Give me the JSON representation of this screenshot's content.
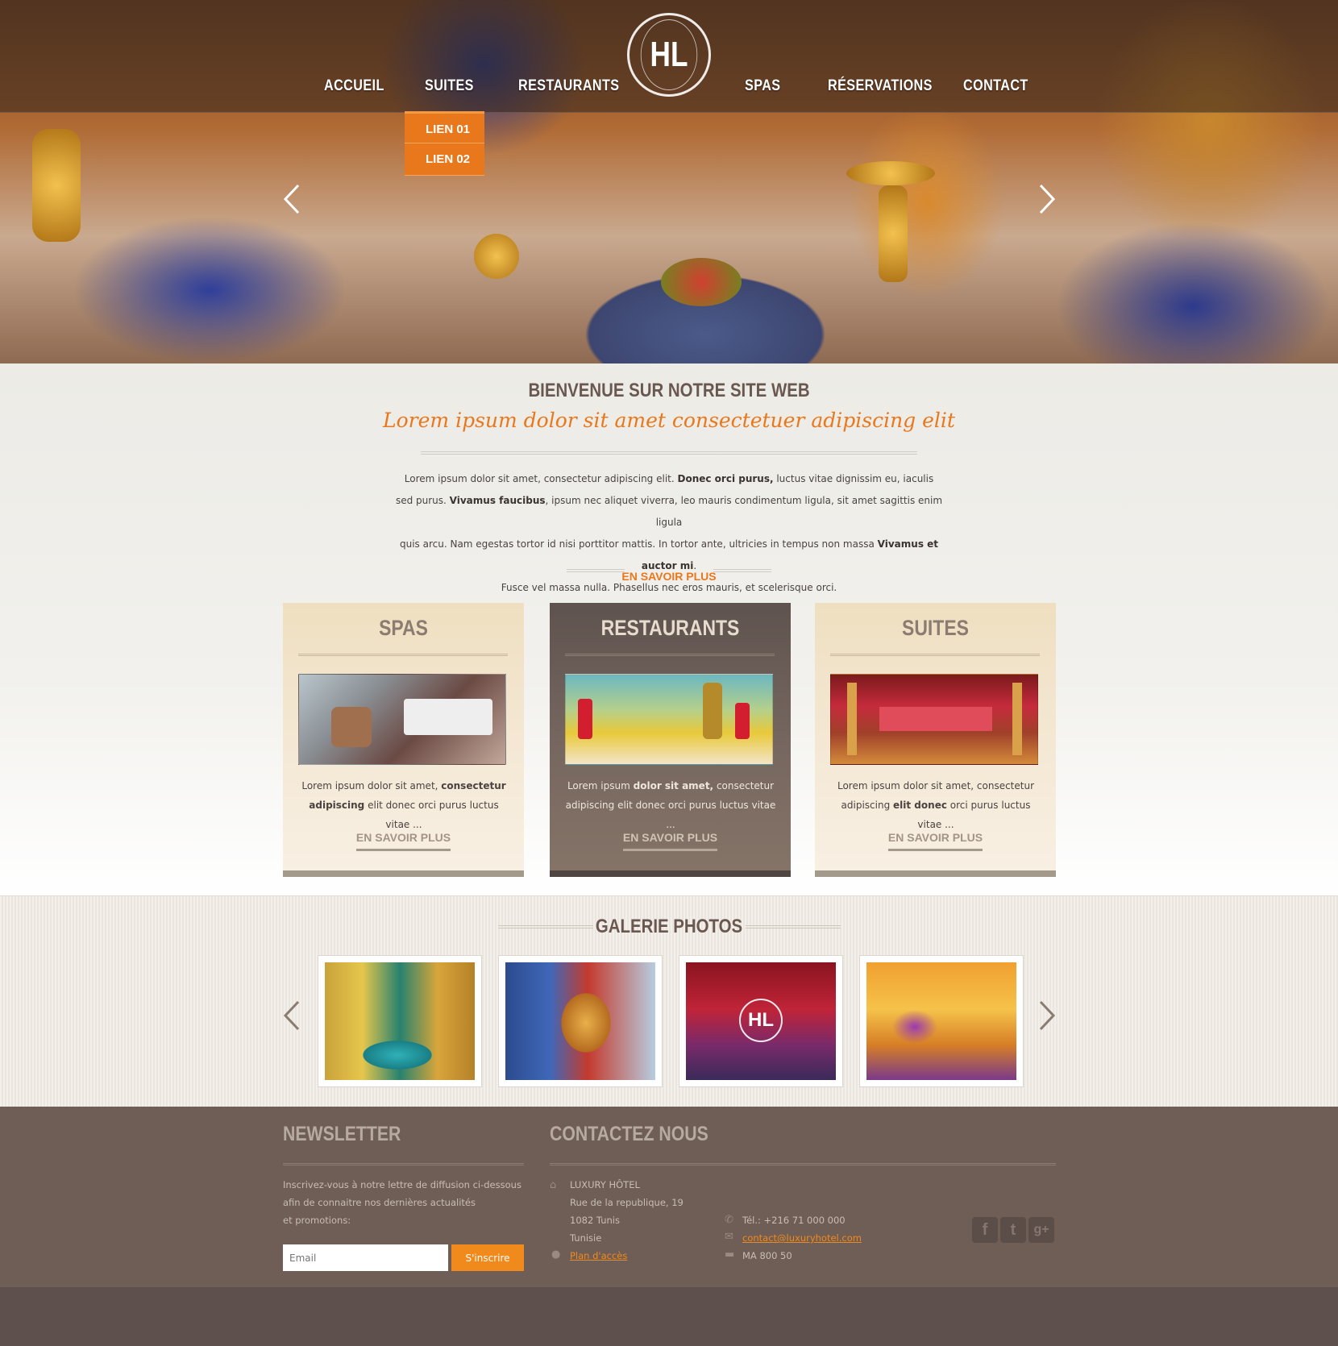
{
  "nav": {
    "items": [
      "ACCUEIL",
      "SUITES",
      "RESTAURANTS",
      "SPAS",
      "RÉSERVATIONS",
      "CONTACT"
    ],
    "logo": "HL",
    "dropdown": [
      "LIEN 01",
      "LIEN 02"
    ]
  },
  "welcome": {
    "title": "BIENVENUE SUR NOTRE SITE WEB",
    "subtitle": "Lorem ipsum dolor sit amet consectetuer adipiscing elit",
    "lines": [
      [
        "Lorem ipsum dolor sit amet, consectetur adipiscing elit. ",
        "Donec orci purus,",
        " luctus vitae dignissim eu, iaculis"
      ],
      [
        "sed purus. ",
        "Vivamus faucibus",
        ", ipsum nec aliquet viverra, leo mauris condimentum ligula, sit amet sagittis enim ligula"
      ],
      [
        "quis arcu. Nam egestas tortor id nisi porttitor mattis. In tortor ante, ultricies in  tempus non massa ",
        "Vivamus et auctor mi",
        "."
      ],
      [
        "Fusce vel massa nulla. Phasellus nec eros mauris, et scelerisque orci.",
        "",
        ""
      ]
    ],
    "more": "EN SAVOIR PLUS"
  },
  "cards": [
    {
      "title": "SPAS",
      "text": [
        "Lorem ipsum dolor sit amet, ",
        "consectetur adipiscing",
        " elit donec orci purus luctus vitae ..."
      ],
      "more": "EN SAVOIR PLUS"
    },
    {
      "title": "RESTAURANTS",
      "text": [
        "Lorem ipsum ",
        "dolor sit amet,",
        " consectetur adipiscing elit donec orci purus luctus vitae ..."
      ],
      "more": "EN SAVOIR PLUS"
    },
    {
      "title": "SUITES",
      "text": [
        "Lorem ipsum dolor sit amet, consectetur adipiscing ",
        "elit donec",
        " orci purus luctus vitae ..."
      ],
      "more": "EN SAVOIR PLUS"
    }
  ],
  "gallery": {
    "title": "GALERIE PHOTOS",
    "badge": "HL"
  },
  "footer": {
    "newsletter_title": "NEWSLETTER",
    "newsletter_text": [
      "Inscrivez-vous à notre lettre de diffusion ci-dessous",
      "afin de connaitre nos dernières actualités",
      "et promotions:"
    ],
    "email_placeholder": "Email",
    "subscribe_label": "S'inscrire",
    "contact_title": "CONTACTEZ NOUS",
    "address": [
      "LUXURY HÔTEL",
      "Rue de la republique, 19",
      "1082 Tunis",
      "Tunisie"
    ],
    "map_link": "Plan d'accès",
    "phone": "Tél.: +216 71 000 000",
    "email": "contact@luxuryhotel.com",
    "fax": "MA 800 50",
    "social": [
      "f",
      "t",
      "g+"
    ]
  },
  "colors": {
    "accent": "#e9781d",
    "footer_bg": "#6f5e56",
    "brown_title": "#6a5850"
  }
}
